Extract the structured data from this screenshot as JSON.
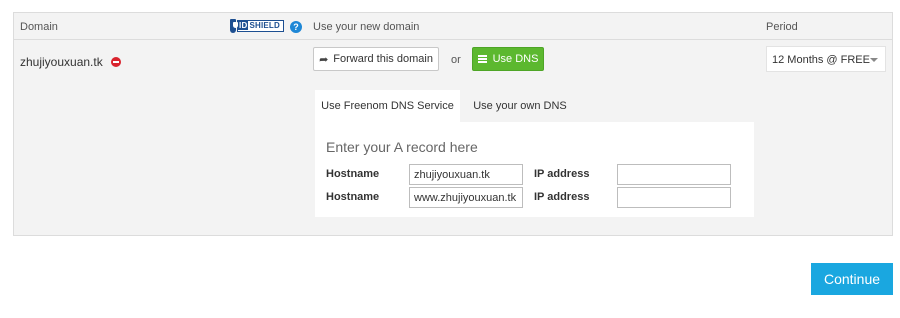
{
  "table": {
    "col_domain": "Domain",
    "col_new_domain": "Use your new domain",
    "col_period": "Period",
    "idshield_logo": {
      "id": "ID",
      "rest": "SHIELD"
    },
    "help_icon": "question-circle",
    "help_symbol": "?"
  },
  "row": {
    "domain": "zhujiyouxuan.tk",
    "remove_icon": "remove-circle",
    "forward_label": "Forward this domain",
    "forward_icon": "share-arrow",
    "or_text": "or",
    "dns_label": "Use DNS",
    "dns_icon": "list",
    "period_value": "12 Months @ FREE"
  },
  "dns": {
    "tabs": [
      {
        "label": "Use Freenom DNS Service",
        "active": true
      },
      {
        "label": "Use your own DNS",
        "active": false
      }
    ],
    "title": "Enter your A record here",
    "records": [
      {
        "hostname_label": "Hostname",
        "hostname_value": "zhujiyouxuan.tk",
        "ip_label": "IP address",
        "ip_value": ""
      },
      {
        "hostname_label": "Hostname",
        "hostname_value": "www.zhujiyouxuan.tk",
        "ip_label": "IP address",
        "ip_value": ""
      }
    ]
  },
  "footer": {
    "continue_label": "Continue"
  },
  "colors": {
    "green": "#5cb82f",
    "blue": "#1aa7e0",
    "red": "#d9232d",
    "shield_blue": "#1d4f91"
  }
}
